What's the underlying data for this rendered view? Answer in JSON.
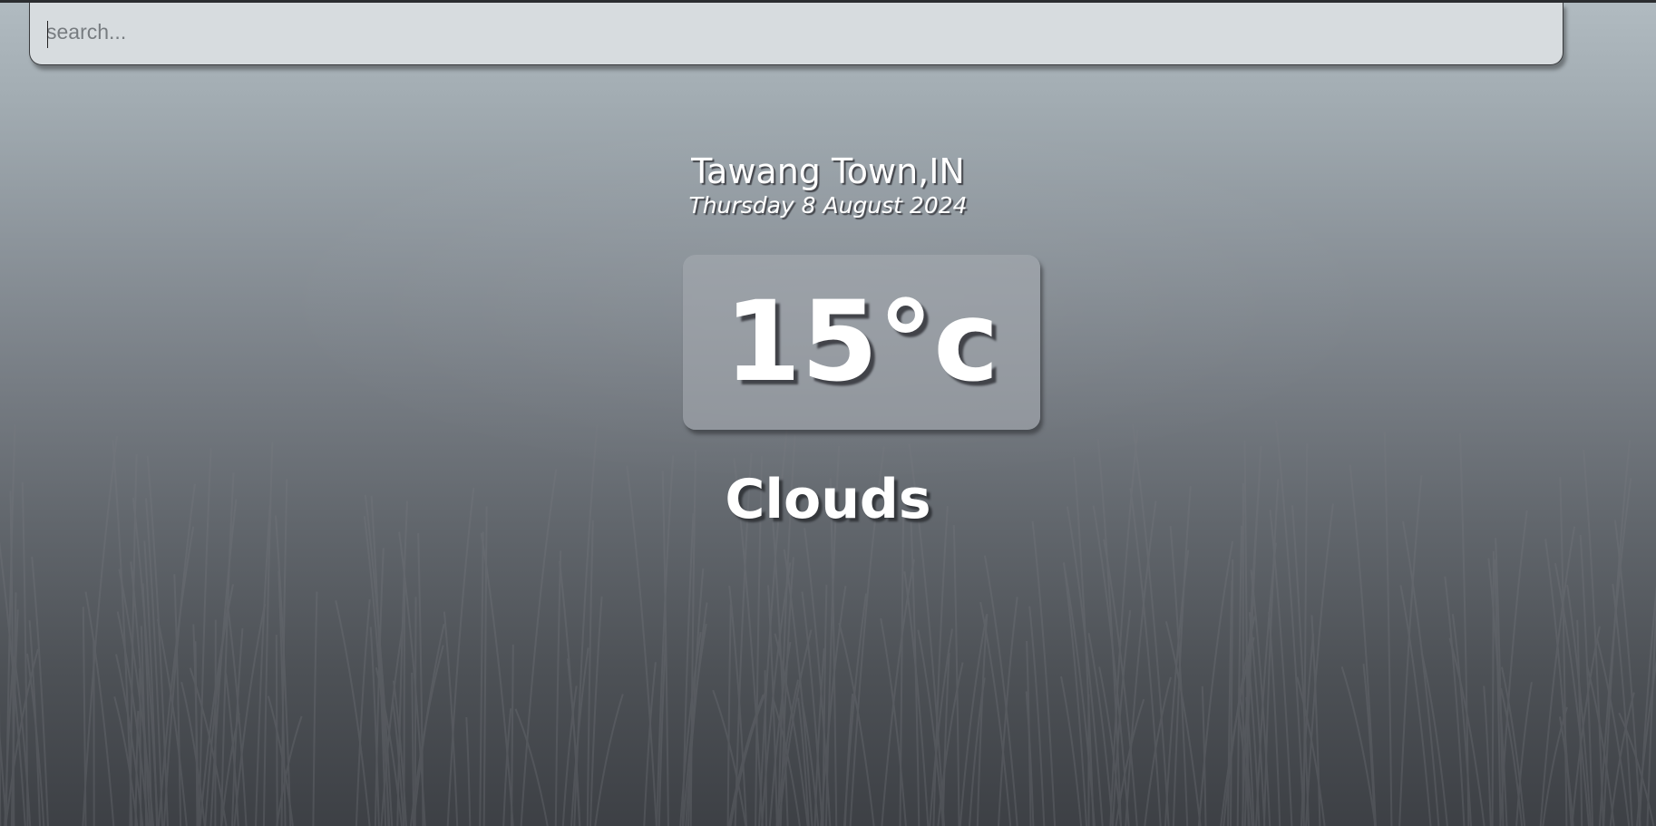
{
  "search": {
    "placeholder": "search...",
    "value": ""
  },
  "location": {
    "city": "Tawang Town,IN",
    "date": "Thursday 8 August 2024"
  },
  "weather": {
    "temperature": "15°c",
    "condition": "Clouds"
  },
  "colors": {
    "text": "#ffffff",
    "search_bg": "#d7dcdf",
    "sky_top": "#b1bbc1",
    "ground_bottom": "#3d4045"
  }
}
